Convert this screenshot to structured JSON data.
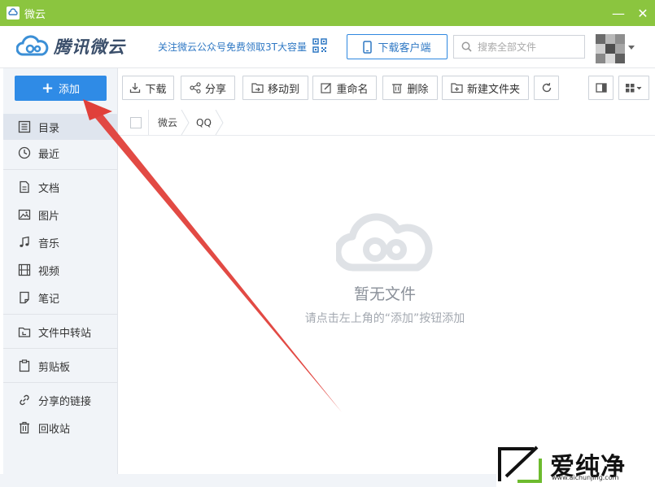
{
  "window": {
    "title": "微云",
    "minimize": "—",
    "close": "✕"
  },
  "header": {
    "logo_text": "腾讯微云",
    "promo_text": "关注微云公众号免费领取3T大容量",
    "download_client_label": "下载客户端",
    "search_placeholder": "搜索全部文件"
  },
  "sidebar": {
    "add_label": "添加",
    "items": [
      {
        "label": "目录",
        "icon": "list-icon"
      },
      {
        "label": "最近",
        "icon": "clock-icon"
      },
      {
        "label": "文档",
        "icon": "document-icon"
      },
      {
        "label": "图片",
        "icon": "image-icon"
      },
      {
        "label": "音乐",
        "icon": "music-icon"
      },
      {
        "label": "视频",
        "icon": "video-icon"
      },
      {
        "label": "笔记",
        "icon": "note-icon"
      },
      {
        "label": "文件中转站",
        "icon": "transfer-icon"
      },
      {
        "label": "剪贴板",
        "icon": "clipboard-icon"
      },
      {
        "label": "分享的链接",
        "icon": "link-icon"
      },
      {
        "label": "回收站",
        "icon": "trash-icon"
      }
    ]
  },
  "toolbar": {
    "download": "下载",
    "share": "分享",
    "move_to": "移动到",
    "rename": "重命名",
    "delete": "删除",
    "new_folder": "新建文件夹"
  },
  "breadcrumb": {
    "items": [
      "微云",
      "QQ"
    ]
  },
  "empty_state": {
    "title": "暂无文件",
    "hint": "请点击左上角的“添加”按钮添加"
  },
  "watermark": {
    "text": "爱纯净",
    "url": "www.aichunjing.com"
  },
  "colors": {
    "titlebar": "#8bc53f",
    "accent": "#2f8be6",
    "arrow": "#e0403a"
  }
}
